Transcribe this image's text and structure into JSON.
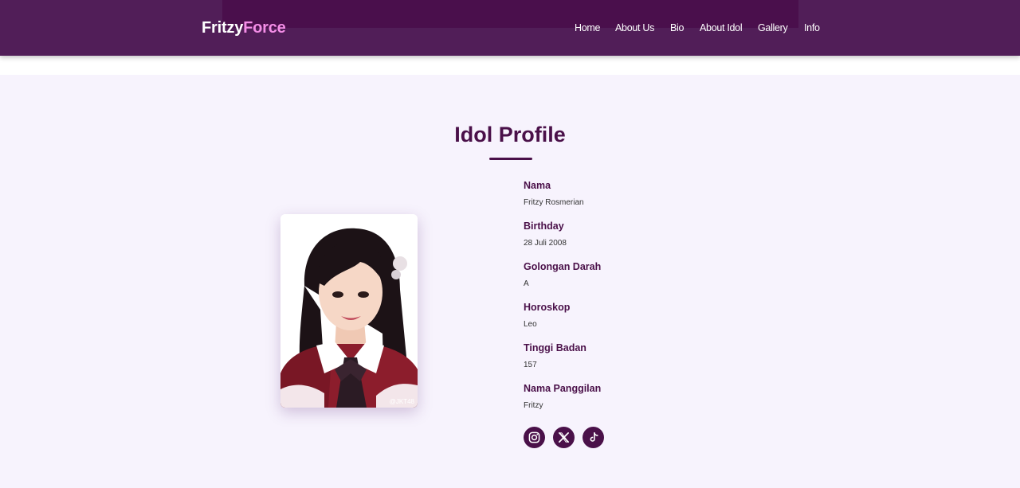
{
  "header": {
    "logo_part1": "Fritzy",
    "logo_part2": "Force",
    "nav": [
      "Home",
      "About Us",
      "Bio",
      "About Idol",
      "Gallery",
      "Info"
    ]
  },
  "main": {
    "title": "Idol Profile",
    "photo_watermark": "@JKT48",
    "fields": [
      {
        "label": "Nama",
        "value": "Fritzy Rosmerian"
      },
      {
        "label": "Birthday",
        "value": "28 Juli 2008"
      },
      {
        "label": "Golongan Darah",
        "value": "A"
      },
      {
        "label": "Horoskop",
        "value": "Leo"
      },
      {
        "label": "Tinggi Badan",
        "value": "157"
      },
      {
        "label": "Nama Panggilan",
        "value": "Fritzy"
      }
    ],
    "socials": [
      "instagram-icon",
      "x-icon",
      "tiktok-icon"
    ]
  },
  "colors": {
    "header_bg": "#511e58",
    "accent": "#4a1049",
    "logo_highlight": "#f48ee7",
    "page_bg": "#f7f3fd"
  }
}
